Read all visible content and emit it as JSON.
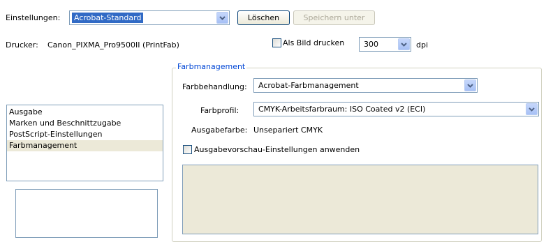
{
  "header": {
    "settings_label": "Einstellungen:",
    "settings_value": "Acrobat-Standard",
    "delete_button": "Löschen",
    "save_as_button": "Speichern unter",
    "printer_label": "Drucker:",
    "printer_name": "Canon_PIXMA_Pro9500II (PrintFab)",
    "print_as_image_label": "Als Bild drucken",
    "print_as_image_checked": false,
    "dpi_value": "300",
    "dpi_unit": "dpi"
  },
  "categories": {
    "items": [
      "Ausgabe",
      "Marken und Beschnittzugabe",
      "PostScript-Einstellungen",
      "Farbmanagement"
    ],
    "selected": "Farbmanagement"
  },
  "color_management": {
    "group_title": "Farbmanagement",
    "handling_label": "Farbbehandlung:",
    "handling_value": "Acrobat-Farbmanagement",
    "profile_label": "Farbprofil:",
    "profile_value": "CMYK-Arbeitsfarbraum: ISO Coated v2 (ECI)",
    "output_color_label": "Ausgabefarbe:",
    "output_color_value": "Unsepariert CMYK",
    "apply_preview_label": "Ausgabevorschau-Einstellungen anwenden",
    "apply_preview_checked": false
  },
  "colors": {
    "selection": "#316ac5",
    "group_title": "#0046d5",
    "panel": "#ece9d8",
    "border": "#7f9db9"
  }
}
